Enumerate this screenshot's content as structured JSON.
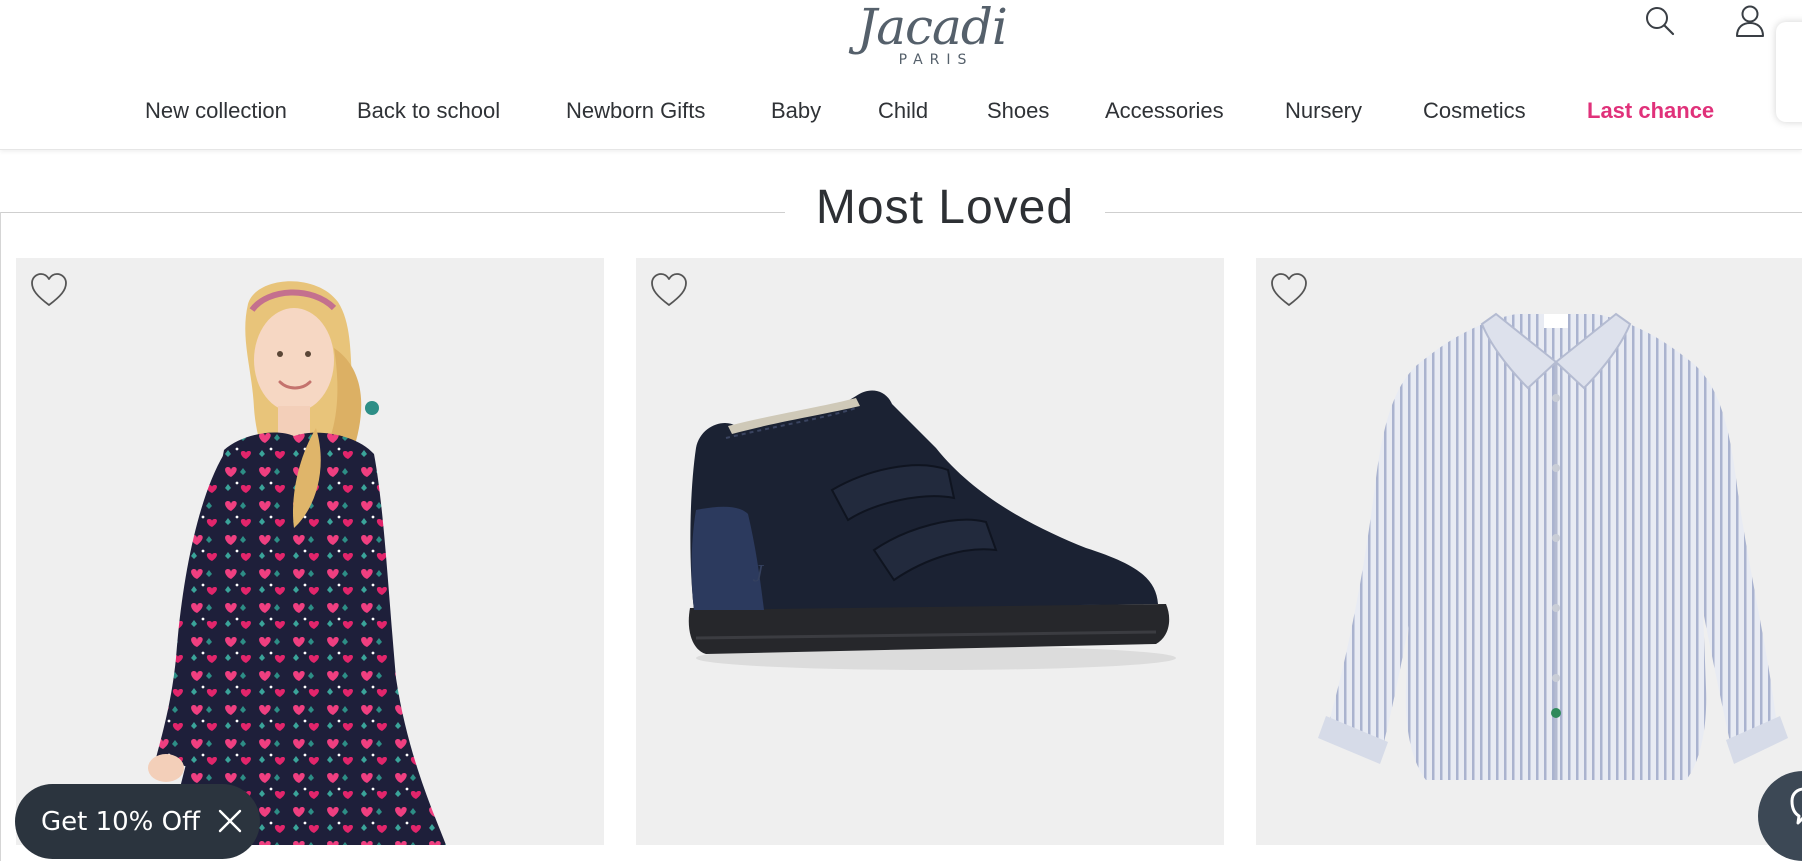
{
  "brand": {
    "name": "Jacadi",
    "logo_script": "Jacadi",
    "logo_sub": "PARIS",
    "color": "#55606b"
  },
  "header": {
    "icons": [
      "search-icon",
      "account-icon"
    ]
  },
  "nav": {
    "items": [
      {
        "label": "New collection"
      },
      {
        "label": "Back to school"
      },
      {
        "label": "Newborn Gifts"
      },
      {
        "label": "Baby"
      },
      {
        "label": "Child"
      },
      {
        "label": "Shoes"
      },
      {
        "label": "Accessories"
      },
      {
        "label": "Nursery"
      },
      {
        "label": "Cosmetics"
      },
      {
        "label": "Last chance",
        "highlight_color": "#e0317a"
      }
    ]
  },
  "section": {
    "title": "Most Loved"
  },
  "products": [
    {
      "image": "girl-in-heart-print-dress",
      "wishlist_icon": "heart-outline-icon"
    },
    {
      "image": "navy-suede-velcro-boot",
      "wishlist_icon": "heart-outline-icon"
    },
    {
      "image": "blue-striped-oxford-shirt",
      "wishlist_icon": "heart-outline-icon"
    }
  ],
  "promo": {
    "label": "Get 10% Off",
    "close_icon": "close-icon",
    "background": "#2b343e"
  },
  "chat": {
    "icon": "chat-icon",
    "background": "#3c4855"
  }
}
